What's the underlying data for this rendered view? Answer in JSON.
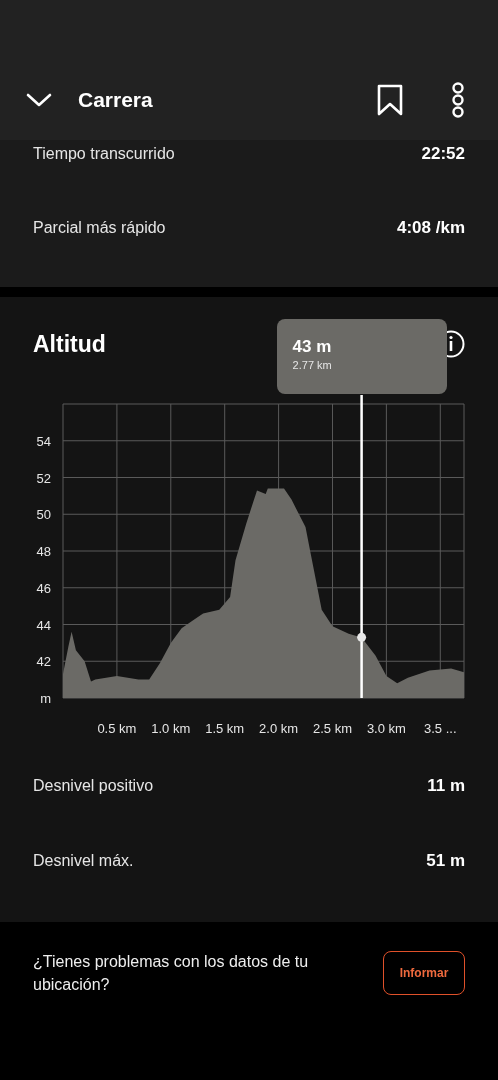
{
  "header": {
    "title": "Carrera"
  },
  "stats": [
    {
      "label": "Tiempo transcurrido",
      "value": "22:52"
    },
    {
      "label": "Parcial más rápido",
      "value": "4:08 /km"
    }
  ],
  "altitude": {
    "title": "Altitud",
    "chart_data": {
      "type": "area",
      "grid": true,
      "xlim": [
        0,
        3.72
      ],
      "ylim": [
        40,
        56
      ],
      "xticks": [
        {
          "value": 0.5,
          "label": "0.5 km"
        },
        {
          "value": 1.0,
          "label": "1.0 km"
        },
        {
          "value": 1.5,
          "label": "1.5 km"
        },
        {
          "value": 2.0,
          "label": "2.0 km"
        },
        {
          "value": 2.5,
          "label": "2.5 km"
        },
        {
          "value": 3.0,
          "label": "3.0 km"
        },
        {
          "value": 3.5,
          "label": "3.5 ..."
        }
      ],
      "yticks": [
        {
          "value": 40,
          "label": "m"
        },
        42,
        44,
        46,
        48,
        50,
        52,
        54
      ],
      "x": [
        0,
        0.05,
        0.08,
        0.12,
        0.2,
        0.26,
        0.3,
        0.5,
        0.7,
        0.8,
        0.9,
        1.0,
        1.1,
        1.2,
        1.3,
        1.45,
        1.55,
        1.6,
        1.7,
        1.8,
        1.88,
        1.9,
        2.05,
        2.12,
        2.25,
        2.3,
        2.4,
        2.5,
        2.65,
        2.77,
        2.9,
        3.0,
        3.1,
        3.2,
        3.4,
        3.6,
        3.72
      ],
      "series": [
        {
          "color": "#6b6a66",
          "values": [
            41.3,
            42.8,
            43.6,
            42.6,
            42.0,
            40.9,
            41.0,
            41.2,
            41.0,
            41.0,
            41.9,
            43.0,
            43.8,
            44.2,
            44.6,
            44.8,
            45.5,
            47.5,
            49.5,
            51.3,
            51.1,
            51.4,
            51.4,
            50.8,
            49.3,
            47.8,
            44.8,
            43.9,
            43.5,
            43.3,
            42.3,
            41.2,
            40.8,
            41.1,
            41.5,
            41.6,
            41.4
          ]
        }
      ],
      "ref_lines": [
        {
          "axis": "x",
          "value": 2.77,
          "label": "2.77 km"
        }
      ],
      "annotations": [
        "43 m"
      ]
    },
    "rows": [
      {
        "label": "Desnivel positivo",
        "value": "11 m"
      },
      {
        "label": "Desnivel máx.",
        "value": "51 m"
      }
    ]
  },
  "footer": {
    "text": "¿Tienes problemas con los datos de tu ubicación?",
    "button": "Informar"
  }
}
